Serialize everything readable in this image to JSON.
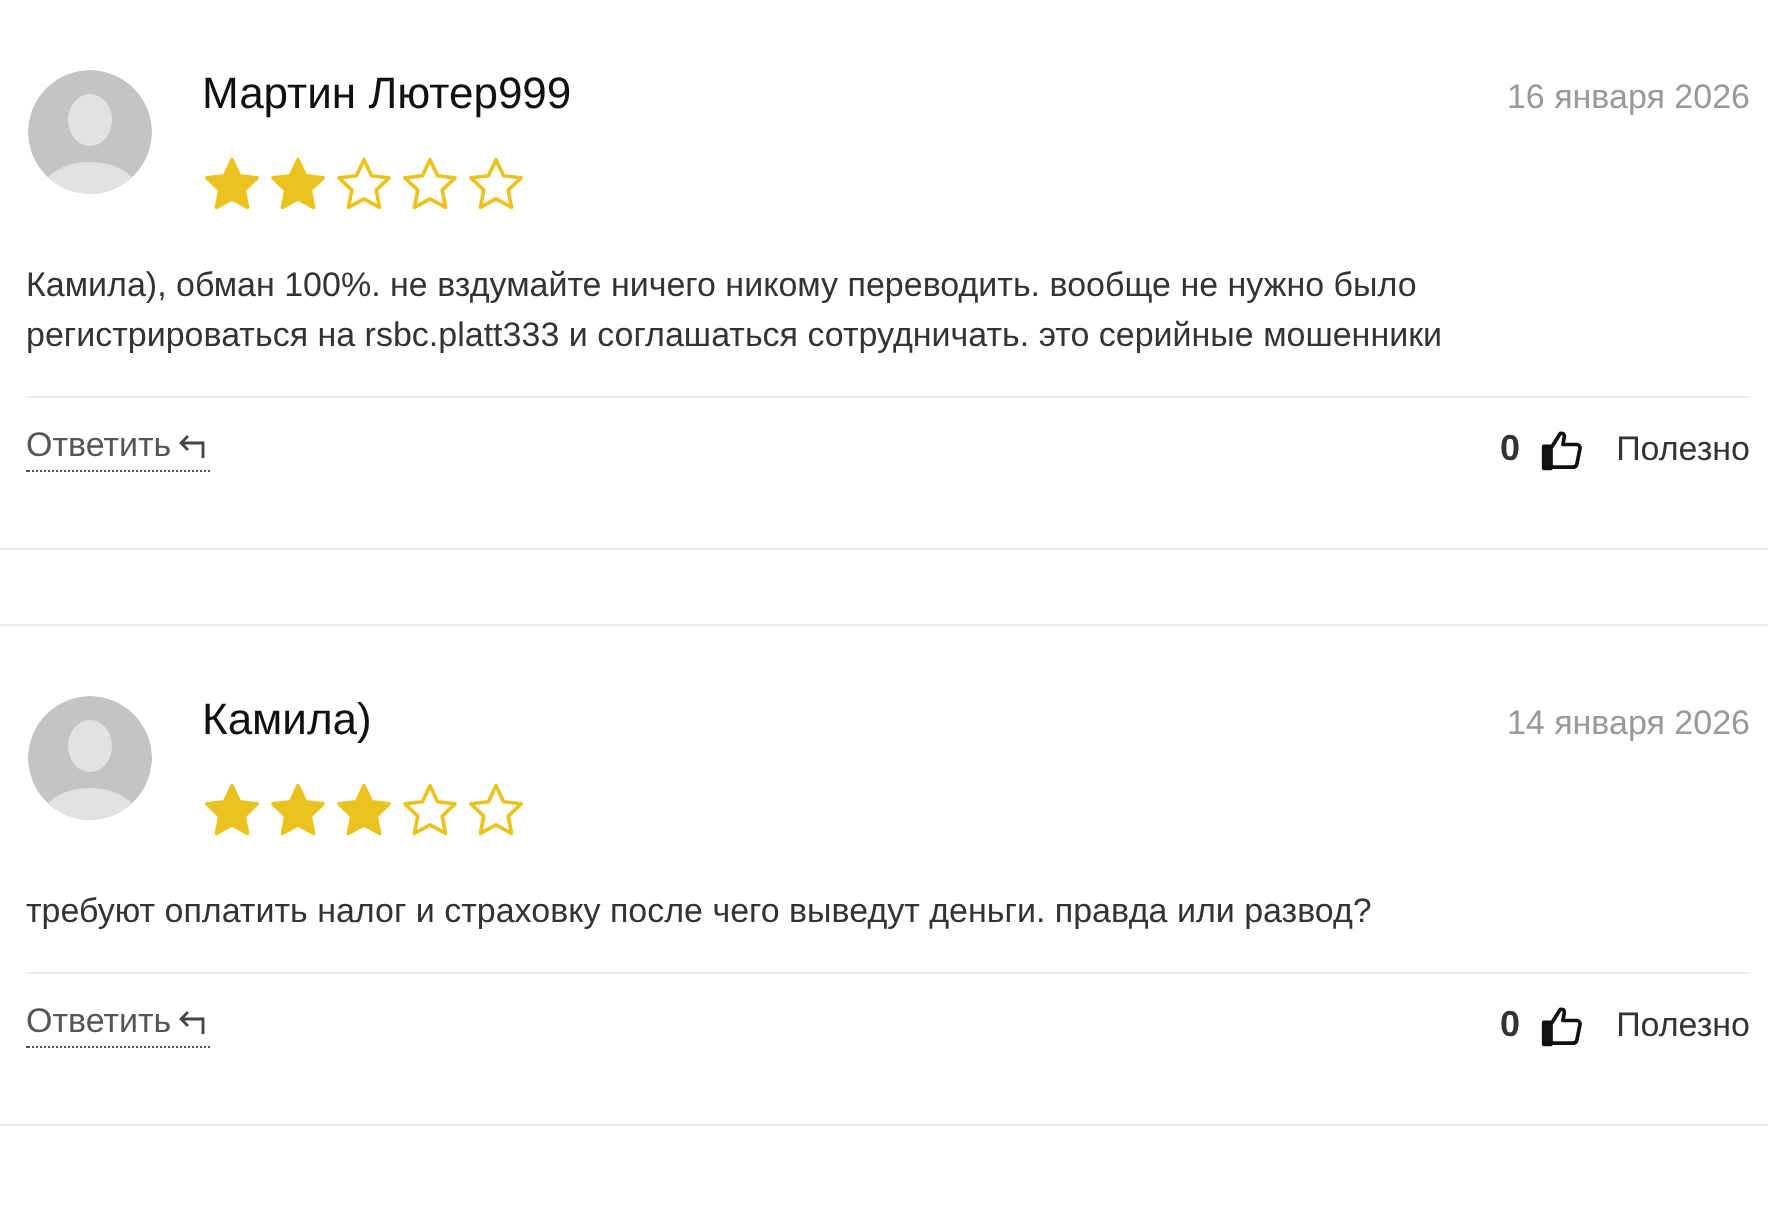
{
  "reviews": [
    {
      "author": "Мартин Лютер999",
      "date": "16 января 2026",
      "stars": 2,
      "text": "Камила), обман 100%. не вздумайте ничего никому переводить. вообще не нужно было регистрироваться на rsbc.platt333 и соглашаться сотрудничать. это серийные мошенники",
      "reply": "Ответить",
      "likes": "0",
      "useful": "Полезно"
    },
    {
      "author": "Камила)",
      "date": "14 января 2026",
      "stars": 3,
      "text": "требуют оплатить налог и страховку после чего выведут деньги. правда или развод?",
      "reply": "Ответить",
      "likes": "0",
      "useful": "Полезно"
    }
  ]
}
